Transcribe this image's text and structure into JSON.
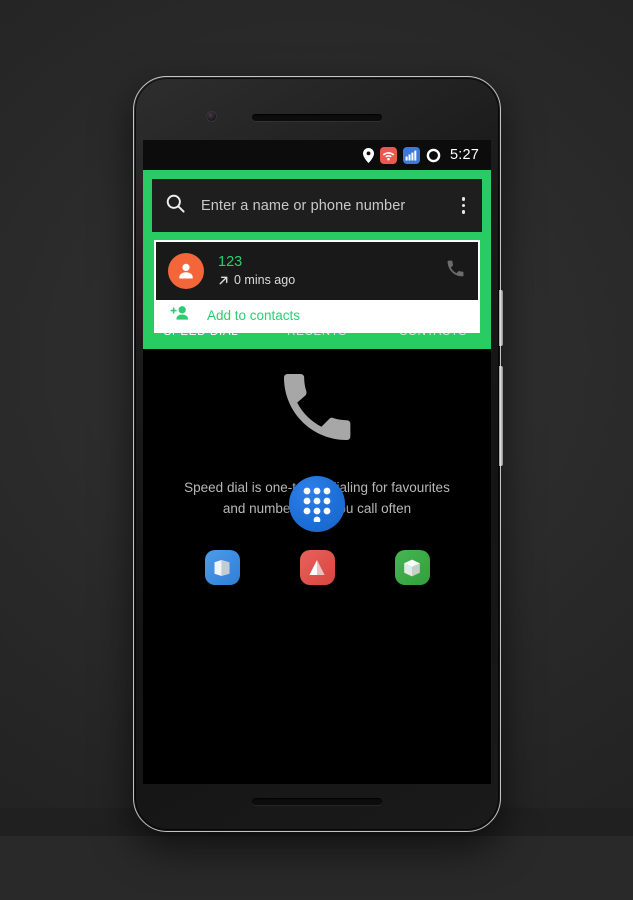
{
  "device": {
    "name": "android-phone-mockup"
  },
  "statusbar": {
    "time": "5:27",
    "icons": [
      {
        "name": "location-pin-icon",
        "color": "#ffffff"
      },
      {
        "name": "wifi-icon",
        "color": "#e8594f"
      },
      {
        "name": "signal-bars-icon",
        "color": "#3d7ad6"
      },
      {
        "name": "battery-ring-icon",
        "color": "#ffffff"
      }
    ]
  },
  "highlight": {
    "color": "#29cc63"
  },
  "search": {
    "placeholder": "Enter a name or phone number",
    "value": "",
    "icon": "search-icon",
    "overflow_icon": "more-vert-icon"
  },
  "contact": {
    "name": "123",
    "call_direction_icon": "outgoing-call-arrow",
    "time_ago": "0 mins ago",
    "avatar_icon": "person-icon",
    "avatar_color": "#f4663a",
    "name_color": "#2ecc71",
    "call_icon": "phone-handset-icon",
    "add_contacts_label": "Add to contacts",
    "add_contacts_icon": "person-add-icon",
    "add_contacts_color": "#2ecc71"
  },
  "tabs": [
    {
      "label": "SPEED DIAL",
      "active": true
    },
    {
      "label": "RECENTS",
      "active": false
    },
    {
      "label": "CONTACTS",
      "active": false
    }
  ],
  "empty_state": {
    "icon": "phone-handset-large-icon",
    "line1": "Speed dial is one-touch dialing for favourites",
    "line2": "and numbers that you call often"
  },
  "fab": {
    "name": "dialpad-fab",
    "icon": "dialpad-icon",
    "color": "#1d6fd8"
  },
  "apps": [
    {
      "name": "app-icon-blue-box",
      "icon": "box-open-icon",
      "color": "#2f7fd6"
    },
    {
      "name": "app-icon-red-pyramid",
      "icon": "pyramid-icon",
      "color": "#d8463f"
    },
    {
      "name": "app-icon-green-cube",
      "icon": "cube-icon",
      "color": "#31a03c"
    }
  ]
}
